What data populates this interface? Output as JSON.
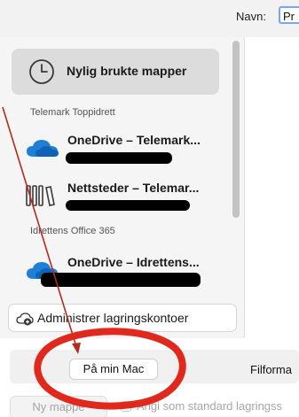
{
  "header": {
    "name_label": "Navn:",
    "name_value": "Pr"
  },
  "sidebar": {
    "recent": {
      "label": "Nylig brukte mapper",
      "icon": "clock-icon"
    },
    "sections": [
      {
        "title": "Telemark Toppidrett",
        "items": [
          {
            "label": "OneDrive – Telemark...",
            "icon": "onedrive-cloud-icon"
          },
          {
            "label": "Nettsteder – Telemar...",
            "icon": "sites-library-icon"
          }
        ]
      },
      {
        "title": "Idrettens Office 365",
        "items": [
          {
            "label": "OneDrive – Idrettens...",
            "icon": "onedrive-cloud-icon"
          }
        ]
      }
    ],
    "manage_button": {
      "label": "Administrer lagringskontoer",
      "icon": "cloud-add-icon"
    }
  },
  "bottom": {
    "mac_button": "På min Mac",
    "format_label": "Filforma",
    "new_folder_button": "Ny mappe",
    "default_checkbox_label": "Angi som standard lagringss"
  },
  "colors": {
    "annotation": "#e0291c",
    "onedrive_blue": "#1f7fd6",
    "name_border": "#7aa5f5"
  }
}
